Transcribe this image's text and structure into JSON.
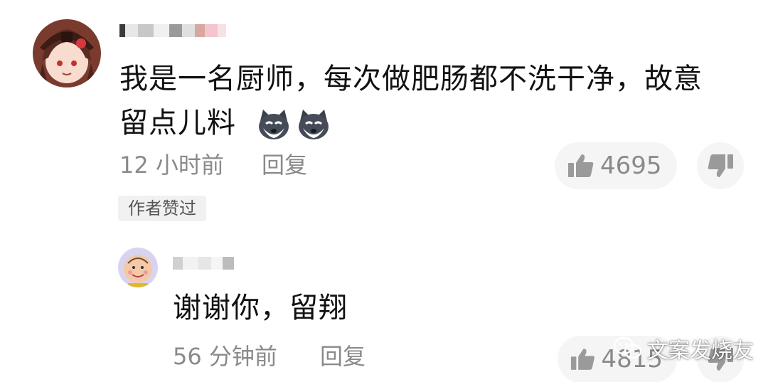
{
  "comment": {
    "text_line1": "我是一名厨师，每次做肥肠都不洗干净，故意",
    "text_line2": "留点儿料",
    "emojis": [
      "husky-dog-emoji",
      "husky-dog-emoji"
    ],
    "time": "12 小时前",
    "reply_label": "回复",
    "likes": "4695",
    "author_badge": "作者赞过"
  },
  "reply": {
    "text": "谢谢你，留翔",
    "time": "56 分钟前",
    "reply_label": "回复",
    "likes": "4815"
  },
  "watermark": {
    "text": "文案发烧友",
    "icon": "wechat-icon"
  },
  "icons": {
    "like": "thumbs-up-icon",
    "dislike": "thumbs-down-icon"
  },
  "colors": {
    "text_primary": "#111111",
    "text_meta": "#8a8a8a",
    "pill_bg": "#f5f5f5",
    "badge_bg": "#f1f1f1"
  }
}
